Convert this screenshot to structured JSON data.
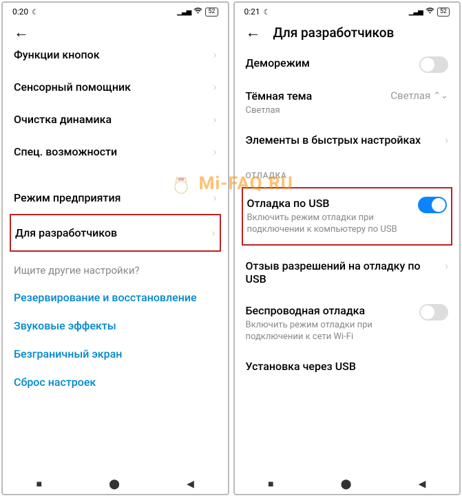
{
  "watermark": "Mi-FAQ.RU",
  "left": {
    "status": {
      "time": "0:20",
      "battery": "52"
    },
    "cut_item": "Функции кнопок",
    "items": [
      "Сенсорный помощник",
      "Очистка динамика",
      "Спец. возможности",
      "Режим предприятия"
    ],
    "highlighted": "Для разработчиков",
    "search_hint": "Ищите другие настройки?",
    "links": [
      "Резервирование и восстановление",
      "Звуковые эффекты",
      "Безграничный экран",
      "Сброс настроек"
    ]
  },
  "right": {
    "status": {
      "time": "0:21",
      "battery": "52"
    },
    "header": "Для разработчиков",
    "items": {
      "demo": {
        "title": "Деморежим"
      },
      "theme": {
        "title": "Тёмная тема",
        "sub": "Светлая",
        "value": "Светлая"
      },
      "quick": {
        "title": "Элементы в быстрых настройках"
      }
    },
    "section_label": "ОТЛАДКА",
    "usb_debug": {
      "title": "Отладка по USB",
      "sub": "Включить режим отладки при подключении к компьютеру по USB"
    },
    "revoke": {
      "title": "Отзыв разрешений на отладку по USB"
    },
    "wireless": {
      "title": "Беспроводная отладка",
      "sub": "Включить режим отладки при подключении к сети Wi-Fi"
    },
    "install": {
      "title": "Установка через USB"
    }
  }
}
